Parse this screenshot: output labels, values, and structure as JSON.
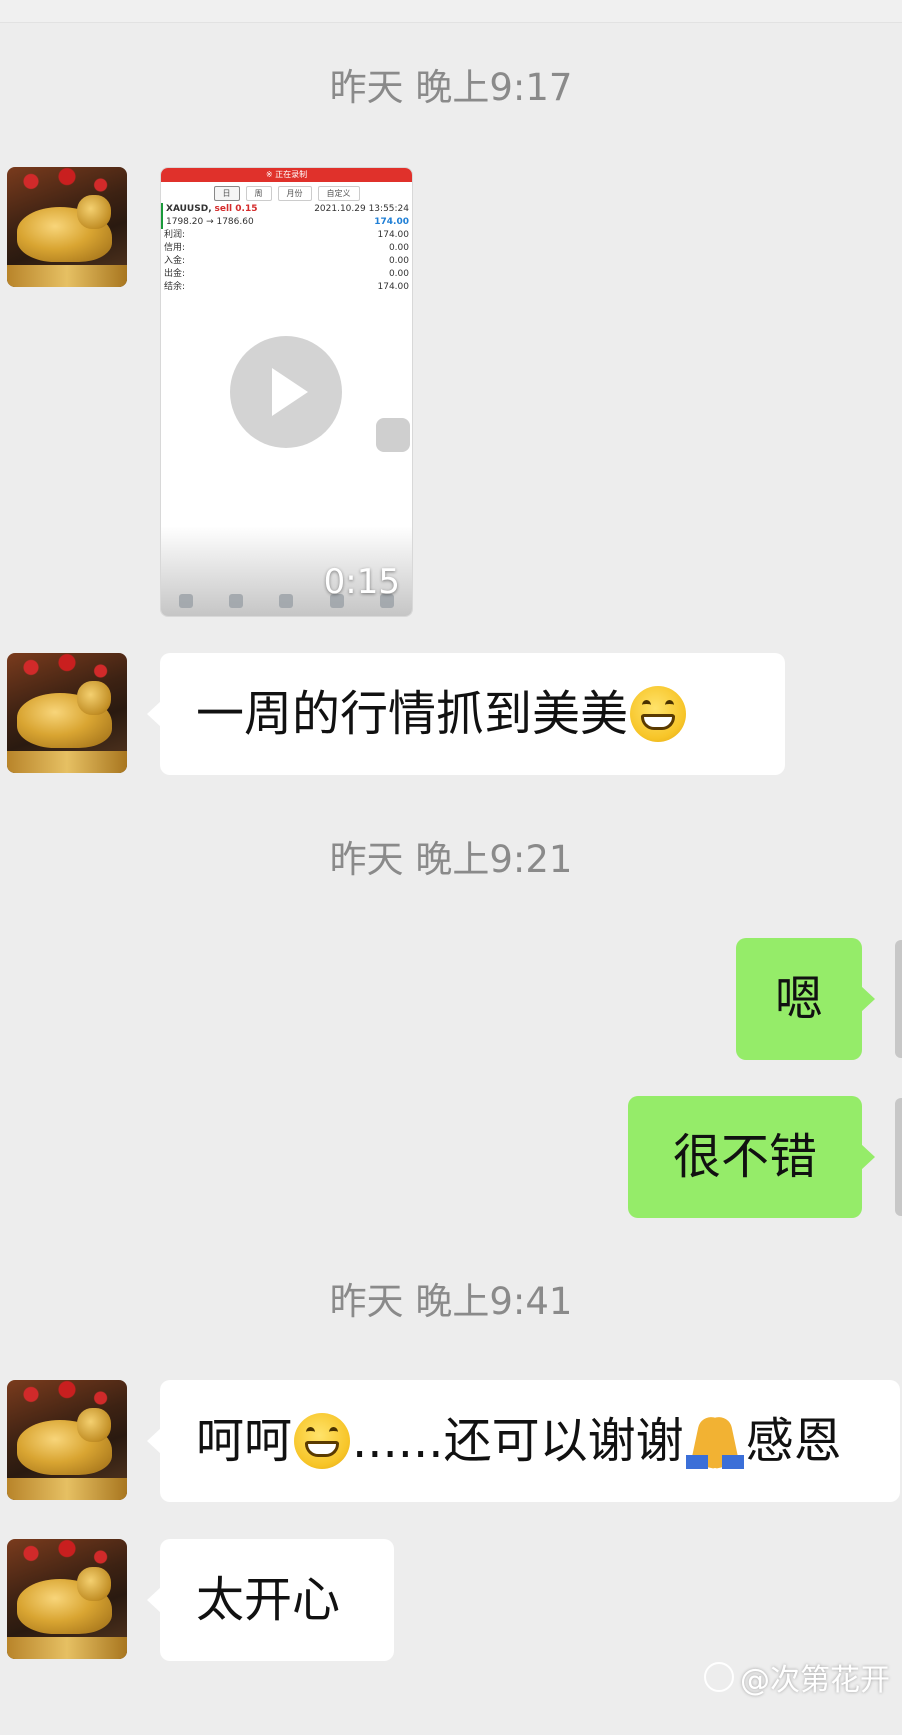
{
  "timestamps": [
    "昨天 晚上9:17",
    "昨天 晚上9:21",
    "昨天 晚上9:41"
  ],
  "video": {
    "duration": "0:15",
    "screen": {
      "banner": "※ 正在录制",
      "tabs": [
        "日",
        "周",
        "月份",
        "自定义"
      ],
      "symbol": "XAUUSD,",
      "order": "sell 0.15",
      "datetime": "2021.10.29 13:55:24",
      "prices": "1798.20 → 1786.60",
      "profit_value": "174.00",
      "rows": [
        {
          "label": "利润:",
          "value": "174.00"
        },
        {
          "label": "信用:",
          "value": "0.00"
        },
        {
          "label": "入金:",
          "value": "0.00"
        },
        {
          "label": "出金:",
          "value": "0.00"
        },
        {
          "label": "结余:",
          "value": "174.00"
        }
      ]
    }
  },
  "messages": {
    "m1": "一周的行情抓到美美",
    "m2": "嗯",
    "m3": "很不错",
    "m4_a": "呵呵",
    "m4_b": "......还可以谢谢",
    "m4_c": "感恩",
    "m5": "太开心"
  },
  "watermark": "@次第花开",
  "colors": {
    "background": "#ededed",
    "incoming_bubble": "#ffffff",
    "outgoing_bubble": "#95ec69",
    "timestamp": "#8a8a8a"
  },
  "icons": [
    "play-icon",
    "grin-emoji-icon",
    "pray-emoji-icon",
    "watermark-logo-icon"
  ]
}
